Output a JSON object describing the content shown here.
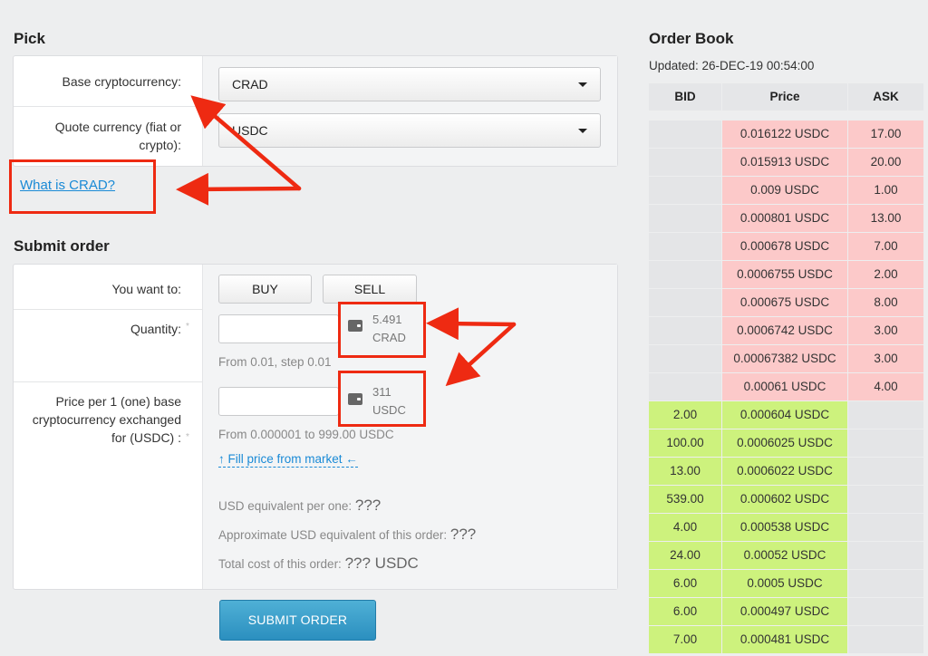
{
  "pick": {
    "heading": "Pick",
    "base_label": "Base cryptocurrency:",
    "base_value": "CRAD",
    "quote_label_line1": "Quote currency (fiat or",
    "quote_label_line2": "crypto):",
    "quote_value": "USDC",
    "what_is_link": "What is CRAD?"
  },
  "order": {
    "heading": "Submit order",
    "want_label": "You want to:",
    "buy": "BUY",
    "sell": "SELL",
    "quantity_label": "Quantity:",
    "quantity_hint": "From 0.01, step 0.01",
    "quantity_balance_amount": "5.491",
    "quantity_balance_unit": "CRAD",
    "price_label_line1": "Price per 1 (one) base",
    "price_label_line2": "cryptocurrency exchanged",
    "price_label_line3": "for (USDC) :",
    "price_hint": "From 0.000001 to 999.00 USDC",
    "price_balance_amount": "311",
    "price_balance_unit": "USDC",
    "fill_price_link": "↑ Fill price from market ←",
    "usd_per_one_label": "USD equivalent per one:",
    "usd_per_one_value": "???",
    "approx_usd_label": "Approximate USD equivalent of this order:",
    "approx_usd_value": "???",
    "total_cost_label": "Total cost of this order:",
    "total_cost_value": "??? USDC",
    "submit": "SUBMIT ORDER",
    "required_mark": "*"
  },
  "order_book": {
    "heading": "Order Book",
    "updated": "Updated: 26-DEC-19 00:54:00",
    "columns": [
      "BID",
      "Price",
      "ASK"
    ],
    "asks": [
      {
        "price": "0.016122 USDC",
        "ask": "17.00"
      },
      {
        "price": "0.015913 USDC",
        "ask": "20.00"
      },
      {
        "price": "0.009 USDC",
        "ask": "1.00"
      },
      {
        "price": "0.000801 USDC",
        "ask": "13.00"
      },
      {
        "price": "0.000678 USDC",
        "ask": "7.00"
      },
      {
        "price": "0.0006755 USDC",
        "ask": "2.00"
      },
      {
        "price": "0.000675 USDC",
        "ask": "8.00"
      },
      {
        "price": "0.0006742 USDC",
        "ask": "3.00"
      },
      {
        "price": "0.00067382 USDC",
        "ask": "3.00"
      },
      {
        "price": "0.00061 USDC",
        "ask": "4.00"
      }
    ],
    "bids": [
      {
        "bid": "2.00",
        "price": "0.000604 USDC"
      },
      {
        "bid": "100.00",
        "price": "0.0006025 USDC"
      },
      {
        "bid": "13.00",
        "price": "0.0006022 USDC"
      },
      {
        "bid": "539.00",
        "price": "0.000602 USDC"
      },
      {
        "bid": "4.00",
        "price": "0.000538 USDC"
      },
      {
        "bid": "24.00",
        "price": "0.00052 USDC"
      },
      {
        "bid": "6.00",
        "price": "0.0005 USDC"
      },
      {
        "bid": "6.00",
        "price": "0.000497 USDC"
      },
      {
        "bid": "7.00",
        "price": "0.000481 USDC"
      }
    ]
  },
  "colors": {
    "ask_bg": "#fcc9c9",
    "bid_bg": "#cdf27d",
    "annotation_red": "#ee2a12",
    "link_blue": "#1a8ad6"
  }
}
